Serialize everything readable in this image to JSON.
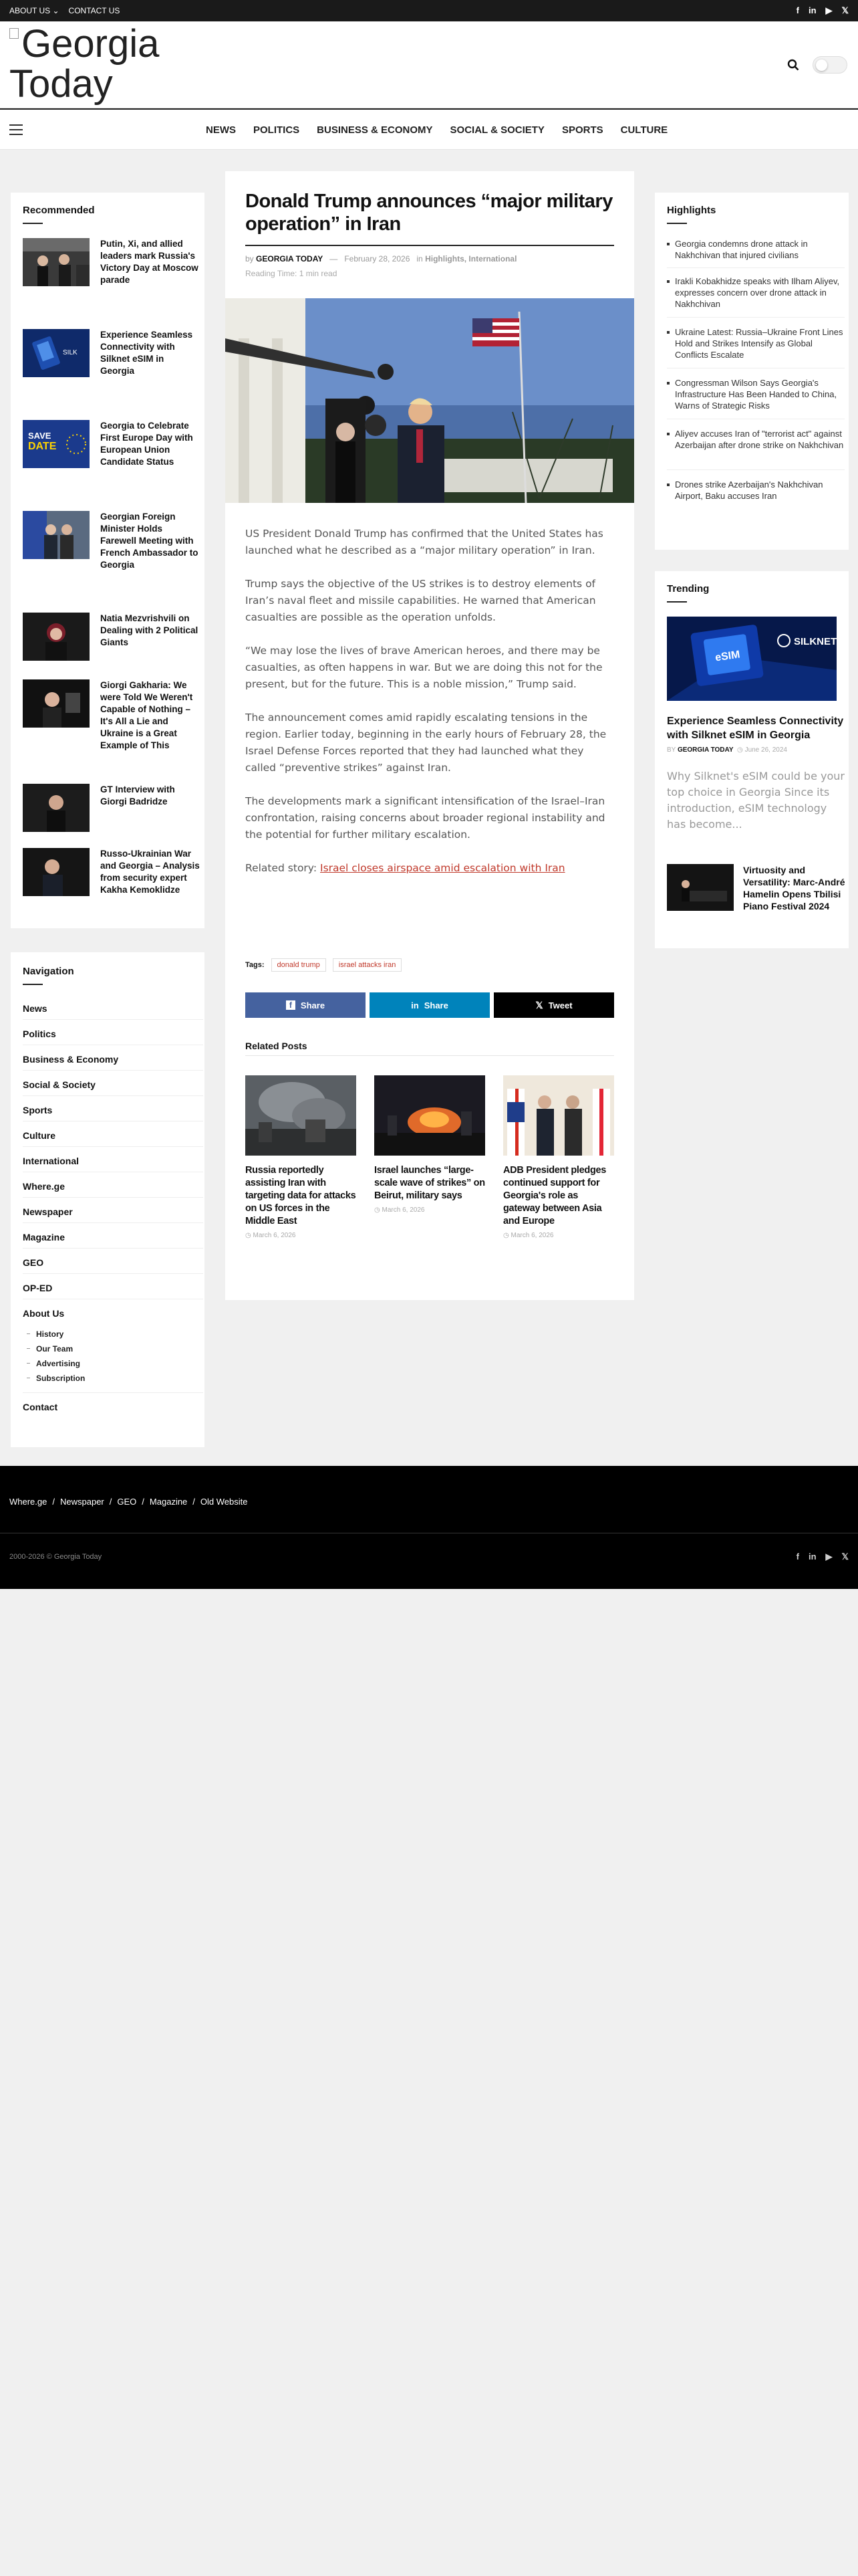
{
  "topbar": {
    "links": [
      "ABOUT US",
      "CONTACT US"
    ],
    "about_arrow": "⌄",
    "social": [
      "f",
      "in",
      "▶",
      "𝕏"
    ]
  },
  "header": {
    "logo_text": "Georgia Today"
  },
  "nav": {
    "items": [
      "NEWS",
      "POLITICS",
      "BUSINESS & ECONOMY",
      "SOCIAL & SOCIETY",
      "SPORTS",
      "CULTURE"
    ]
  },
  "recommended": {
    "title": "Recommended",
    "items": [
      {
        "title": "Putin, Xi, and allied leaders mark Russia's Victory Day at Moscow parade"
      },
      {
        "title": "Experience Seamless Connectivity with Silknet eSIM in Georgia"
      },
      {
        "title": "Georgia to Celebrate First Europe Day with European Union Candidate Status"
      },
      {
        "title": "Georgian Foreign Minister Holds Farewell Meeting with French Ambassador to Georgia"
      },
      {
        "title": "Natia Mezvrishvili on Dealing with 2 Political Giants"
      },
      {
        "title": "Giorgi Gakharia: We were Told We Weren't Capable of Nothing – It's All a Lie and Ukraine is a Great Example of This"
      },
      {
        "title": "GT Interview with Giorgi Badridze"
      },
      {
        "title": "Russo-Ukrainian War and Georgia – Analysis from security expert Kakha Kemoklidze"
      }
    ]
  },
  "navigation_widget": {
    "title": "Navigation",
    "items": [
      "News",
      "Politics",
      "Business & Economy",
      "Social & Society",
      "Sports",
      "Culture",
      "International",
      "Where.ge",
      "Newspaper",
      "Magazine",
      "GEO",
      "OP-ED",
      "About Us"
    ],
    "sub_items": [
      "History",
      "Our Team",
      "Advertising",
      "Subscription"
    ],
    "last_item": "Contact"
  },
  "article": {
    "title": "Donald Trump announces “major military operation” in Iran",
    "by": "by",
    "author": "GEORGIA TODAY",
    "dash": "—",
    "date": "February 28, 2026",
    "in": "in",
    "categories": "Highlights, International",
    "reading_time": "Reading Time: 1 min read",
    "paragraphs": [
      "US President Donald Trump has confirmed that the United States has launched what he described as a “major military operation” in Iran.",
      "Trump says the objective of the US strikes is to destroy elements of Iran’s naval fleet and missile capabilities. He warned that American casualties are possible as the operation unfolds.",
      "“We may lose the lives of brave American heroes, and there may be casualties, as often happens in war. But we are doing this not for the present, but for the future. This is a noble mission,” Trump said.",
      "The announcement comes amid rapidly escalating tensions in the region. Earlier today, beginning in the early hours of February 28, the Israel Defense Forces reported that they had launched what they called “preventive strikes” against Iran.",
      "The developments mark a significant intensification of the Israel–Iran confrontation, raising concerns about broader regional instability and the potential for further military escalation."
    ],
    "related_label": "Related story: ",
    "related_link": "Israel closes airspace amid escalation with Iran",
    "tags_label": "Tags:",
    "tags": [
      "donald trump",
      "israel attacks iran"
    ],
    "share": {
      "facebook": "Share",
      "linkedin": "Share",
      "x": "Tweet"
    },
    "related_posts_title": "Related Posts",
    "related_posts": [
      {
        "title": "Russia reportedly assisting Iran with targeting data for attacks on US forces in the Middle East",
        "date": "March 6, 2026"
      },
      {
        "title": "Israel launches “large-scale wave of strikes” on Beirut, military says",
        "date": "March 6, 2026"
      },
      {
        "title": "ADB President pledges continued support for Georgia's role as gateway between Asia and Europe",
        "date": "March 6, 2026"
      }
    ]
  },
  "highlights": {
    "title": "Highlights",
    "items": [
      "Georgia condemns drone attack in Nakhchivan that injured civilians",
      "Irakli Kobakhidze speaks with Ilham Aliyev, expresses concern over drone attack in Nakhchivan",
      "Ukraine Latest: Russia–Ukraine Front Lines Hold and Strikes Intensify as Global Conflicts Escalate",
      "Congressman Wilson Says Georgia's Infrastructure Has Been Handed to China, Warns of Strategic Risks",
      "Aliyev accuses Iran of \"terrorist act\" against Azerbaijan after drone strike on Nakhchivan",
      "Drones strike Azerbaijan's Nakhchivan Airport, Baku accuses Iran"
    ]
  },
  "trending": {
    "title": "Trending",
    "image_brand": "SILKNET",
    "image_badge": "eSIM",
    "big_title": "Experience Seamless Connectivity with Silknet eSIM in Georgia",
    "by": "BY",
    "author": "GEORGIA TODAY",
    "date": "June 26, 2024",
    "excerpt": "Why Silknet's eSIM could be your top choice in Georgia Since its introduction, eSIM technology has become...",
    "small_title": "Virtuosity and Versatility: Marc-André Hamelin Opens Tbilisi Piano Festival 2024"
  },
  "footer": {
    "links": [
      "Where.ge",
      "Newspaper",
      "GEO",
      "Magazine",
      "Old Website"
    ],
    "separator": "/",
    "copyright": "2000-2026 © Georgia Today",
    "social": [
      "f",
      "in",
      "▶",
      "𝕏"
    ]
  },
  "colors": {
    "link_red": "#c0392b",
    "facebook": "#45629f",
    "linkedin": "#0083bb",
    "x": "#000000",
    "topbar": "#1a1a1a"
  }
}
